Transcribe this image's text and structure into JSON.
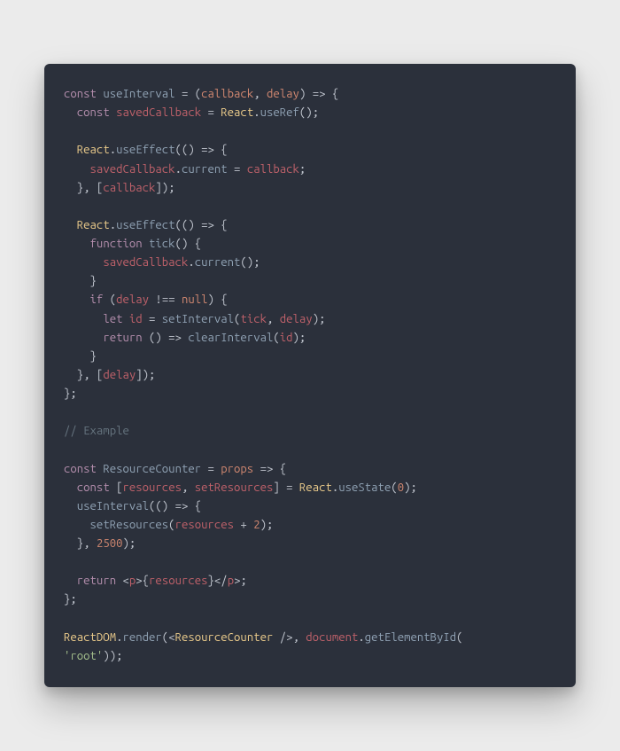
{
  "code": {
    "l01_const": "const",
    "l01_name": "useInterval",
    "l01_eq": " = ",
    "l01_p_open": "(",
    "l01_arg1": "callback",
    "l01_comma": ", ",
    "l01_arg2": "delay",
    "l01_p_close": ")",
    "l01_arrow": " => ",
    "l01_brace": "{",
    "l02_indent": "  ",
    "l02_const": "const",
    "l02_sp": " ",
    "l02_name": "savedCallback",
    "l02_eq": " = ",
    "l02_react": "React",
    "l02_dot": ".",
    "l02_useref": "useRef",
    "l02_call": "();",
    "l04_indent": "  ",
    "l04_react": "React",
    "l04_dot": ".",
    "l04_useeffect": "useEffect",
    "l04_open": "(() ",
    "l04_arrow": "=>",
    "l04_sp": " ",
    "l04_brace": "{",
    "l05_indent": "    ",
    "l05_saved": "savedCallback",
    "l05_dot": ".",
    "l05_current": "current",
    "l05_eq": " = ",
    "l05_cb": "callback",
    "l05_semi": ";",
    "l06_indent": "  ",
    "l06_close": "}, [",
    "l06_cb": "callback",
    "l06_end": "]);",
    "l08_indent": "  ",
    "l08_react": "React",
    "l08_dot": ".",
    "l08_useeffect": "useEffect",
    "l08_open": "(() ",
    "l08_arrow": "=>",
    "l08_sp": " ",
    "l08_brace": "{",
    "l09_indent": "    ",
    "l09_function": "function",
    "l09_sp": " ",
    "l09_tick": "tick",
    "l09_parens": "() ",
    "l09_brace": "{",
    "l10_indent": "      ",
    "l10_saved": "savedCallback",
    "l10_dot": ".",
    "l10_current": "current",
    "l10_call": "();",
    "l11_indent": "    ",
    "l11_brace": "}",
    "l12_indent": "    ",
    "l12_if": "if",
    "l12_sp": " ",
    "l12_open": "(",
    "l12_delay": "delay",
    "l12_op": " !== ",
    "l12_null": "null",
    "l12_close": ") ",
    "l12_brace": "{",
    "l13_indent": "      ",
    "l13_let": "let",
    "l13_sp": " ",
    "l13_id": "id",
    "l13_eq": " = ",
    "l13_setint": "setInterval",
    "l13_open": "(",
    "l13_tick": "tick",
    "l13_comma": ", ",
    "l13_delay": "delay",
    "l13_close": ");",
    "l14_indent": "      ",
    "l14_return": "return",
    "l14_sp": " ",
    "l14_arrow_open": "() ",
    "l14_arrow": "=>",
    "l14_sp2": " ",
    "l14_clear": "clearInterval",
    "l14_open": "(",
    "l14_id": "id",
    "l14_close": ");",
    "l15_indent": "    ",
    "l15_brace": "}",
    "l16_indent": "  ",
    "l16_close": "}, [",
    "l16_delay": "delay",
    "l16_end": "]);",
    "l17_brace": "};",
    "l19_comment": "// Example",
    "l21_const": "const",
    "l21_sp": " ",
    "l21_name": "ResourceCounter",
    "l21_eq": " = ",
    "l21_props": "props",
    "l21_arrow": " => ",
    "l21_brace": "{",
    "l22_indent": "  ",
    "l22_const": "const",
    "l22_sp": " ",
    "l22_destr_open": "[",
    "l22_res": "resources",
    "l22_comma": ", ",
    "l22_setres": "setResources",
    "l22_destr_close": "]",
    "l22_eq": " = ",
    "l22_react": "React",
    "l22_dot": ".",
    "l22_usestate": "useState",
    "l22_open": "(",
    "l22_zero": "0",
    "l22_close": ");",
    "l23_indent": "  ",
    "l23_useint": "useInterval",
    "l23_open": "(() ",
    "l23_arrow": "=>",
    "l23_sp": " ",
    "l23_brace": "{",
    "l24_indent": "    ",
    "l24_setres": "setResources",
    "l24_open": "(",
    "l24_res": "resources",
    "l24_plus": " + ",
    "l24_two": "2",
    "l24_close": ");",
    "l25_indent": "  ",
    "l25_close": "}, ",
    "l25_num": "2500",
    "l25_end": ");",
    "l27_indent": "  ",
    "l27_return": "return",
    "l27_sp": " ",
    "l27_lt": "<",
    "l27_p": "p",
    "l27_gt": ">",
    "l27_braceL": "{",
    "l27_res": "resources",
    "l27_braceR": "}",
    "l27_lt2": "</",
    "l27_p2": "p",
    "l27_gt2": ">",
    "l27_semi": ";",
    "l28_brace": "};",
    "l30_reactdom": "ReactDOM",
    "l30_dot": ".",
    "l30_render": "render",
    "l30_open": "(",
    "l30_lt": "<",
    "l30_comp": "ResourceCounter",
    "l30_close_tag": " />",
    "l30_comma": ", ",
    "l30_doc": "document",
    "l30_dot2": ".",
    "l30_getel": "getElementById",
    "l30_open2": "(",
    "l30_str": "'root'",
    "l30_close2": "));"
  }
}
